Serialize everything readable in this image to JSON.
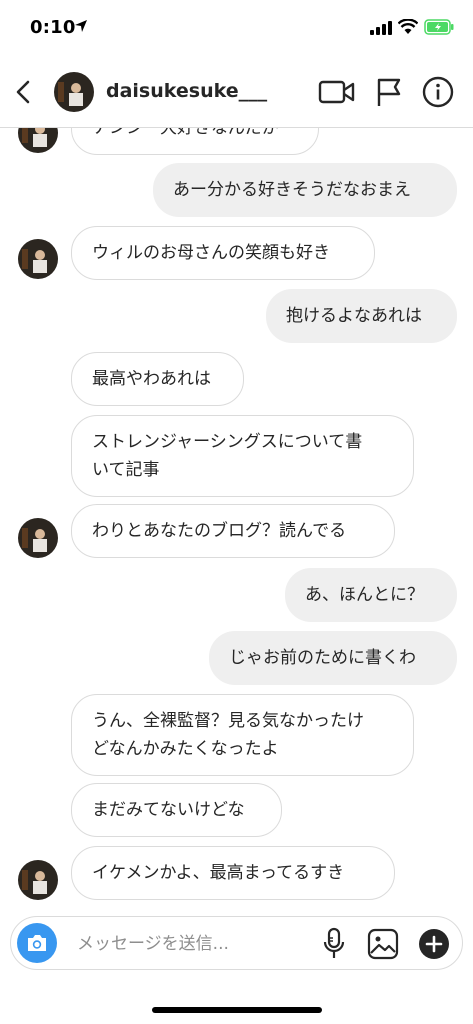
{
  "status_bar": {
    "time": "0:10"
  },
  "header": {
    "username": "daisukesuke___"
  },
  "messages": [
    {
      "direction": "in",
      "text": "ナンシー大好きなんだが",
      "avatar": true
    },
    {
      "direction": "out",
      "text": "あー分かる好きそうだなおまえ"
    },
    {
      "direction": "in",
      "text": "ウィルのお母さんの笑顔も好き",
      "avatar": true
    },
    {
      "direction": "out",
      "text": "抱けるよなあれは"
    },
    {
      "direction": "in",
      "text": "最高やわあれは"
    },
    {
      "direction": "in",
      "line1": "ストレンジャーシングスについて書",
      "line2": "いて記事"
    },
    {
      "direction": "in",
      "text": "わりとあなたのブログ？読んでる",
      "avatar": true
    },
    {
      "direction": "out",
      "text": "あ、ほんとに？"
    },
    {
      "direction": "out",
      "text": "じゃお前のために書くわ"
    },
    {
      "direction": "in",
      "line1": "うん、全裸監督？見る気なかったけ",
      "line2": "どなんかみたくなったよ"
    },
    {
      "direction": "in",
      "text": "まだみてないけどな"
    },
    {
      "direction": "in",
      "text": "イケメンかよ、最高まってるすき",
      "avatar": true
    }
  ],
  "composer": {
    "placeholder": "メッセージを送信..."
  },
  "colors": {
    "accent": "#3897f0",
    "incoming_border": "#dbdbdb",
    "outgoing_bg": "#efefef",
    "battery": "#4cd964"
  },
  "icons": [
    "location-arrow-icon",
    "signal-icon",
    "wifi-icon",
    "battery-icon",
    "back-chevron-icon",
    "video-camera-icon",
    "flag-icon",
    "info-icon",
    "camera-icon",
    "microphone-icon",
    "gallery-icon",
    "plus-icon"
  ]
}
